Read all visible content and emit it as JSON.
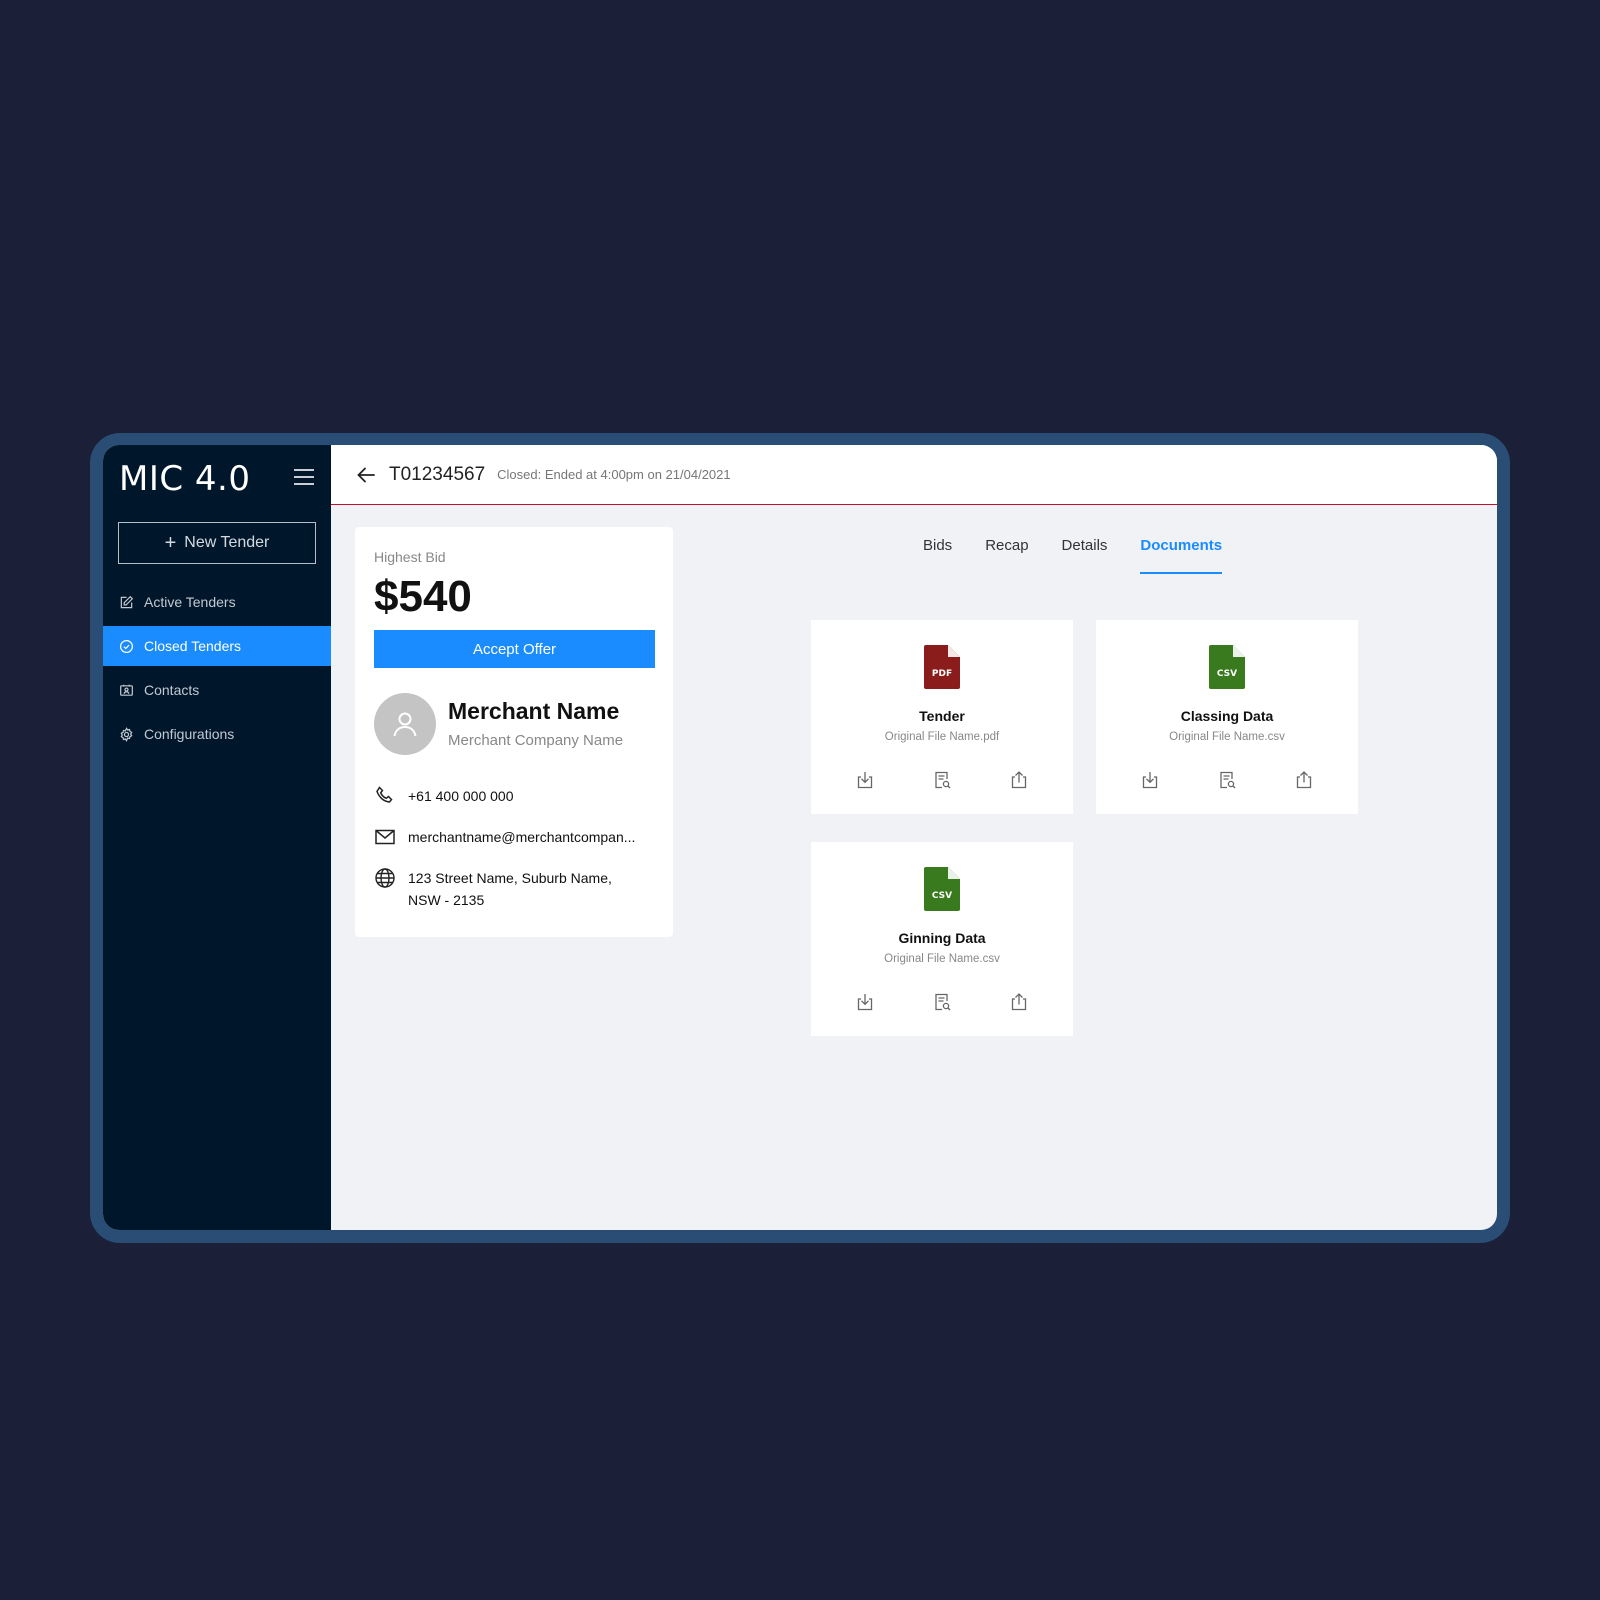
{
  "app": {
    "brand": "MIC 4.0"
  },
  "sidebar": {
    "new_tender_label": "New Tender",
    "items": [
      {
        "label": "Active Tenders",
        "icon": "edit-icon",
        "active": false
      },
      {
        "label": "Closed Tenders",
        "icon": "check-circle-icon",
        "active": true
      },
      {
        "label": "Contacts",
        "icon": "contact-card-icon",
        "active": false
      },
      {
        "label": "Configurations",
        "icon": "gear-icon",
        "active": false
      }
    ]
  },
  "header": {
    "tender_id": "T01234567",
    "status": "Closed: Ended at 4:00pm on 21/04/2021",
    "accent_color": "#c8102e"
  },
  "bid": {
    "label": "Highest Bid",
    "value": "$540",
    "accept_label": "Accept Offer"
  },
  "merchant": {
    "name": "Merchant Name",
    "company": "Merchant Company Name",
    "phone": "+61 400 000 000",
    "email": "merchantname@merchantcompan...",
    "address_line1": "123 Street Name, Suburb Name,",
    "address_line2": "NSW - 2135"
  },
  "tabs": [
    {
      "label": "Bids",
      "active": false
    },
    {
      "label": "Recap",
      "active": false
    },
    {
      "label": "Details",
      "active": false
    },
    {
      "label": "Documents",
      "active": true
    }
  ],
  "documents": [
    {
      "title": "Tender",
      "file": "Original File Name.pdf",
      "type": "PDF",
      "color": "#8b1c1c"
    },
    {
      "title": "Classing Data",
      "file": "Original File Name.csv",
      "type": "CSV",
      "color": "#3a7a1f"
    },
    {
      "title": "Ginning Data",
      "file": "Original File Name.csv",
      "type": "CSV",
      "color": "#3a7a1f"
    }
  ],
  "colors": {
    "primary": "#1a8cff",
    "sidebar": "#00172b",
    "frame": "#2a4d75"
  }
}
